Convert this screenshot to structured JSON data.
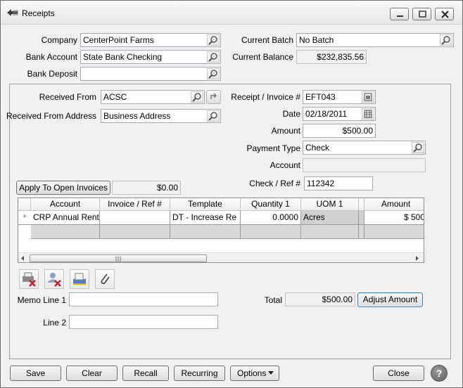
{
  "window": {
    "title": "Receipts"
  },
  "header": {
    "company_label": "Company",
    "company_value": "CenterPoint Farms",
    "bank_account_label": "Bank Account",
    "bank_account_value": "State Bank Checking",
    "bank_deposit_label": "Bank Deposit",
    "bank_deposit_value": "",
    "current_batch_label": "Current Batch",
    "current_batch_value": "No Batch",
    "current_balance_label": "Current Balance",
    "current_balance_value": "$232,835.56"
  },
  "form": {
    "received_from_label": "Received From",
    "received_from_value": "ACSC",
    "received_from_address_label": "Received From Address",
    "received_from_address_value": "Business Address",
    "receipt_invoice_label": "Receipt / Invoice #",
    "receipt_invoice_value": "EFT043",
    "date_label": "Date",
    "date_value": "02/18/2011",
    "amount_label": "Amount",
    "amount_value": "$500.00",
    "payment_type_label": "Payment Type",
    "payment_type_value": "Check",
    "account_label": "Account",
    "account_value": "",
    "check_ref_label": "Check / Ref #",
    "check_ref_value": "112342",
    "apply_button": "Apply To Open Invoices",
    "apply_amount": "$0.00"
  },
  "grid": {
    "columns": [
      "Account",
      "Invoice / Ref #",
      "Template",
      "Quantity 1",
      "UOM 1",
      "Amount"
    ],
    "rows": [
      {
        "account": "CRP Annual Rent",
        "invoice_ref": "",
        "template": "DT - Increase Re",
        "quantity": "0.0000",
        "uom": "Acres",
        "amount": "$ 500"
      }
    ],
    "expander": "+"
  },
  "memo": {
    "memo_line1_label": "Memo Line 1",
    "memo_line1_value": "",
    "line2_label": "Line 2",
    "line2_value": "",
    "total_label": "Total",
    "total_value": "$500.00",
    "adjust_button": "Adjust Amount"
  },
  "footer": {
    "save": "Save",
    "clear": "Clear",
    "recall": "Recall",
    "recurring": "Recurring",
    "options": "Options",
    "close": "Close",
    "help": "?"
  },
  "icons": {
    "lookup": "magnifier-icon",
    "calendar": "calendar-icon",
    "refresh": "refresh-icon",
    "delete_print": "delete-print-icon",
    "delete_user": "delete-user-icon",
    "scan": "scan-icon",
    "attach": "paperclip-icon"
  }
}
